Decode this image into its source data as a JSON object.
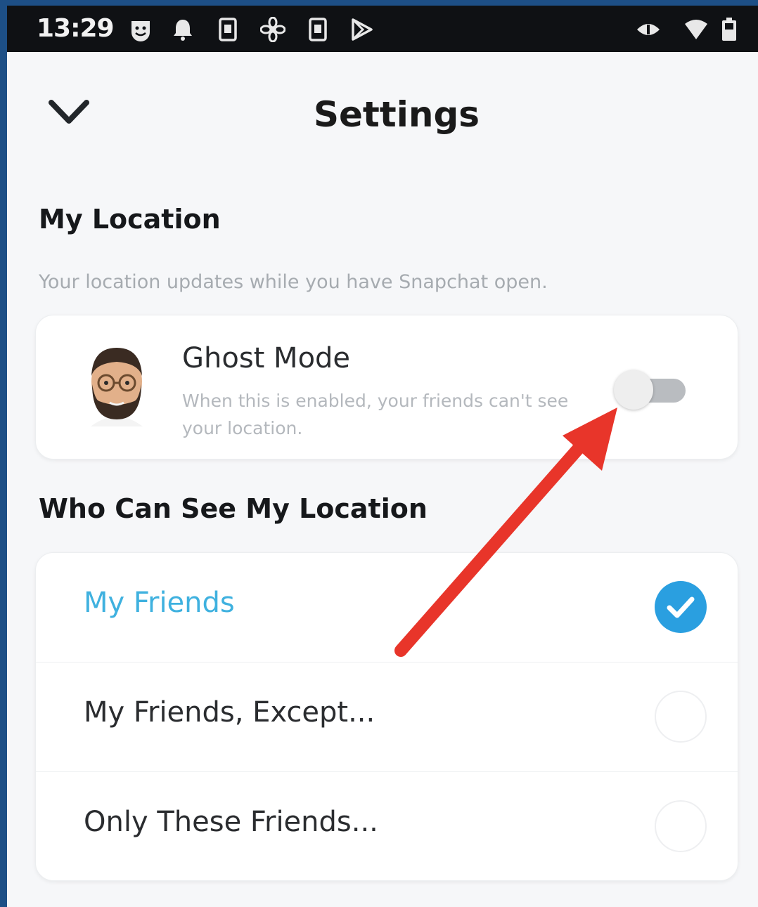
{
  "status_bar": {
    "time": "13:29",
    "left_icons": [
      "smiley-icon",
      "notification-icon",
      "sim-icon",
      "fan-icon",
      "sim-icon",
      "play-store-icon"
    ],
    "right_icons": [
      "data-saver-icon",
      "wifi-icon",
      "battery-icon"
    ]
  },
  "header": {
    "title": "Settings",
    "back_icon": "chevron-down-icon"
  },
  "my_location": {
    "title": "My Location",
    "subtitle": "Your location updates while you have Snapchat open."
  },
  "ghost_mode": {
    "title": "Ghost Mode",
    "description": "When this is enabled, your friends can't see your location.",
    "enabled": false
  },
  "who_can_see": {
    "title": "Who Can See My Location",
    "options": [
      {
        "label": "My Friends",
        "selected": true
      },
      {
        "label": "My Friends, Except...",
        "selected": false
      },
      {
        "label": "Only These Friends...",
        "selected": false
      }
    ]
  },
  "colors": {
    "accent": "#2a9fe0",
    "selected_text": "#3fb1df",
    "annotation_arrow": "#e8352a"
  }
}
